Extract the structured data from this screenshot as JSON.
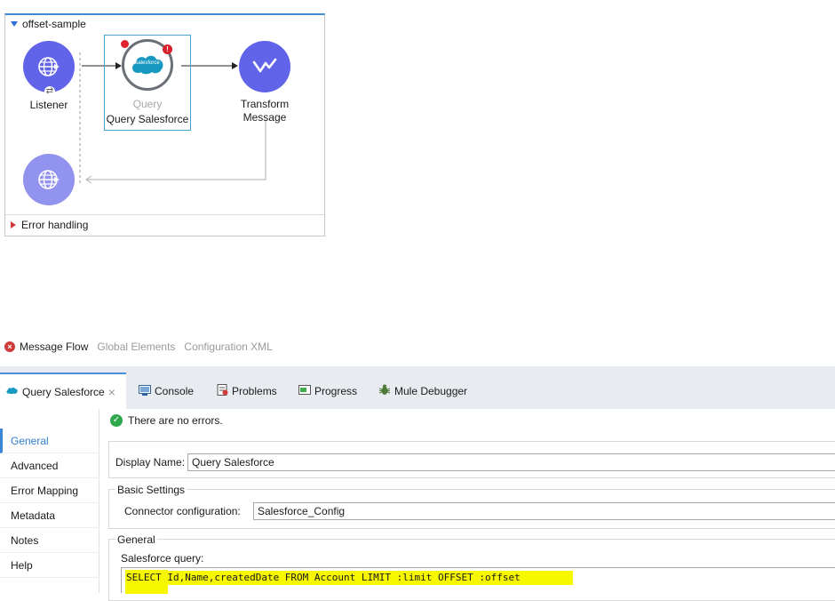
{
  "flow": {
    "name": "offset-sample",
    "listener_label": "Listener",
    "query_top_label": "Query",
    "query_label": "Query Salesforce",
    "salesforce_badge": "salesforce",
    "transform_label_1": "Transform",
    "transform_label_2": "Message",
    "error_handling_label": "Error handling"
  },
  "editor_tabs": {
    "message_flow": "Message Flow",
    "global_elements": "Global Elements",
    "configuration_xml": "Configuration XML"
  },
  "panel_tabs": {
    "query_salesforce": "Query Salesforce",
    "console": "Console",
    "problems": "Problems",
    "progress": "Progress",
    "mule_debugger": "Mule Debugger"
  },
  "sidebar": {
    "items": [
      "General",
      "Advanced",
      "Error Mapping",
      "Metadata",
      "Notes",
      "Help"
    ]
  },
  "content": {
    "status": "There are no errors.",
    "display_name_label": "Display Name:",
    "display_name_value": "Query Salesforce",
    "basic_settings_title": "Basic Settings",
    "connector_config_label": "Connector configuration:",
    "connector_config_value": "Salesforce_Config",
    "general_title": "General",
    "salesforce_query_label": "Salesforce query:",
    "salesforce_query_value": "SELECT Id,Name,createdDate FROM Account LIMIT :limit OFFSET :offset"
  },
  "colors": {
    "accent": "#3b86d6",
    "node_purple": "#6163e8",
    "node_purple_light": "#9293ef",
    "error_red": "#d03b3b",
    "ok_green": "#2ea84b",
    "highlight_yellow": "#f7f700"
  }
}
